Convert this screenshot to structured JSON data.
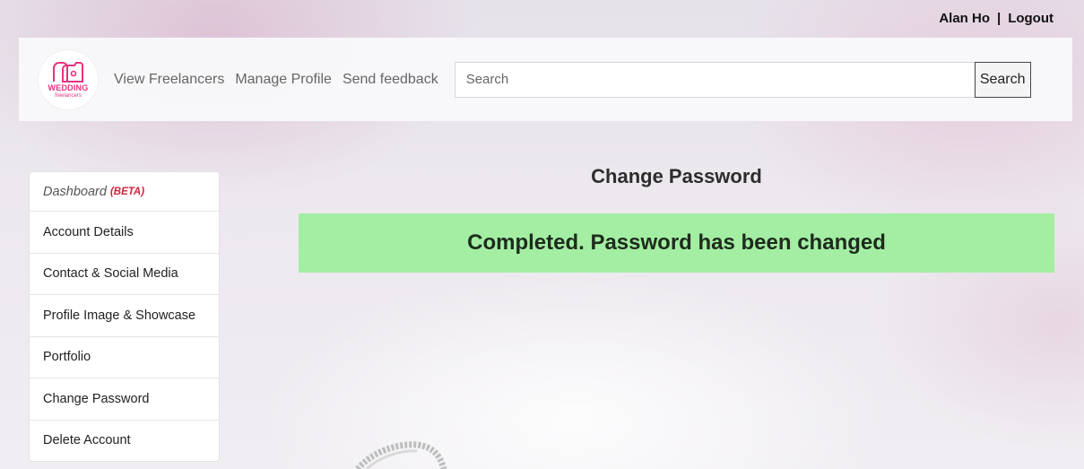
{
  "user": {
    "name": "Alan Ho",
    "separator": "|",
    "logout": "Logout"
  },
  "logo": {
    "brand_top": "WEDDING",
    "brand_bottom": "freelancers",
    "color": "#e9327f"
  },
  "nav": {
    "links": [
      "View Freelancers",
      "Manage Profile",
      "Send feedback"
    ],
    "search_placeholder": "Search",
    "search_button": "Search"
  },
  "sidebar": {
    "items": [
      {
        "label": "Dashboard",
        "badge": "(BETA)"
      },
      {
        "label": "Account Details"
      },
      {
        "label": "Contact & Social Media"
      },
      {
        "label": "Profile Image & Showcase"
      },
      {
        "label": "Portfolio"
      },
      {
        "label": "Change Password"
      },
      {
        "label": "Delete Account"
      }
    ]
  },
  "main": {
    "title": "Change Password",
    "alert": "Completed. Password has been changed",
    "alert_color": "#a3eea3"
  }
}
